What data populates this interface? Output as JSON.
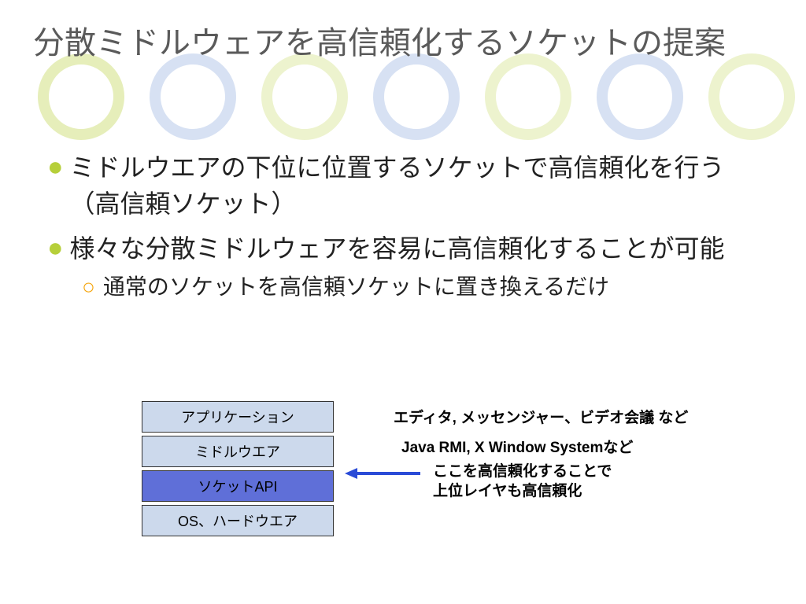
{
  "title": "分散ミドルウェアを高信頼化するソケットの提案",
  "bullets": {
    "b1": "ミドルウエアの下位に位置するソケットで高信頼化を行う（高信頼ソケット）",
    "b2": "様々な分散ミドルウェアを容易に高信頼化することが可能",
    "b2_1": "通常のソケットを高信頼ソケットに置き換えるだけ"
  },
  "stack": {
    "app": "アプリケーション",
    "middleware": "ミドルウエア",
    "socket": "ソケットAPI",
    "os": "OS、ハードウエア"
  },
  "annotations": {
    "app_ex": "エディタ, メッセンジャー、ビデオ会議  など",
    "mw_ex": "Java RMI, X Window Systemなど",
    "socket_note_l1": "ここを高信頼化することで",
    "socket_note_l2": "上位レイヤも高信頼化"
  },
  "colors": {
    "title": "#5a5a5a",
    "bullet1": "#b6cf3a",
    "bullet2": "#f5a60f",
    "box_light": "#ccd9ec",
    "box_socket": "#5f6fd8",
    "arrow": "#2a4bd7"
  }
}
